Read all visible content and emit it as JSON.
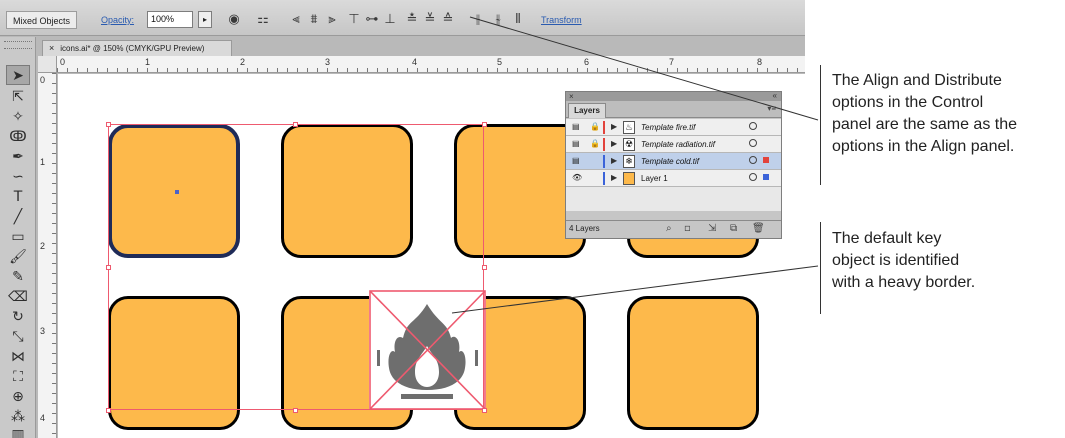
{
  "control_bar": {
    "selection_label": "Mixed Objects",
    "opacity_label": "Opacity:",
    "opacity_value": "100%",
    "opacity_arrow": "▸",
    "transform_label": "Transform"
  },
  "document_tab": {
    "close": "×",
    "title": "icons.ai* @ 150% (CMYK/GPU Preview)"
  },
  "rulers": {
    "top_numbers": [
      "0",
      "1",
      "2",
      "3",
      "4",
      "5",
      "6",
      "7",
      "8"
    ],
    "left_numbers": [
      "0",
      "1",
      "2",
      "3",
      "4"
    ]
  },
  "layers_panel": {
    "tab_label": "Layers",
    "collapse": "«",
    "menu": "▾≡",
    "layers": [
      {
        "name": "Template fire.tif",
        "color": "#e2433c",
        "thumb": "♨",
        "template": true,
        "selected": false
      },
      {
        "name": "Template radiation.tif",
        "color": "#e2433c",
        "thumb": "☢",
        "template": true,
        "selected": false
      },
      {
        "name": "Template cold.tif",
        "color": "#3b63d9",
        "thumb": "❄",
        "template": true,
        "selected": true
      },
      {
        "name": "Layer 1",
        "color": "#3b63d9",
        "thumb": "",
        "template": false,
        "selected": false
      }
    ],
    "footer_count": "4 Layers"
  },
  "callouts": {
    "top": [
      "The Align and Distribute",
      "options in the Control",
      "panel are the same as the",
      "options in the Align panel."
    ],
    "bottom": [
      "The default key",
      "object is identified",
      "with a heavy border."
    ]
  }
}
